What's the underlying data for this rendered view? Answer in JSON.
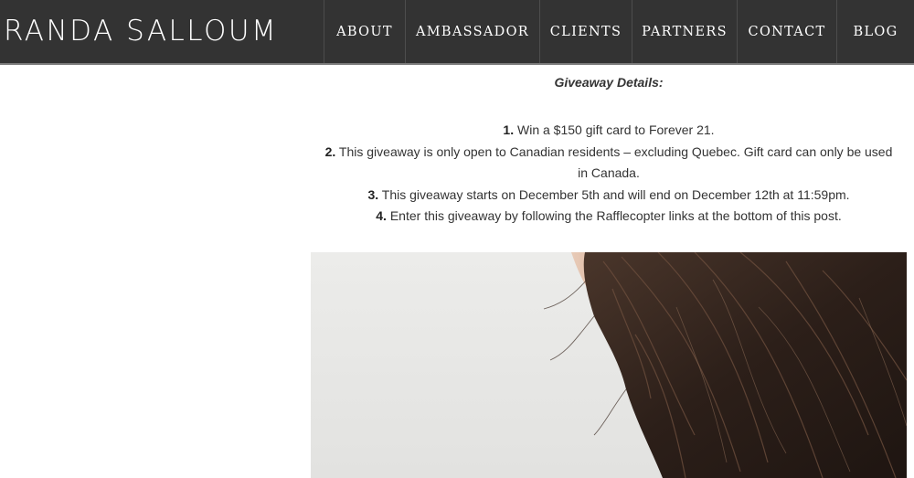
{
  "site": {
    "logo": "RANDA SALLOUM"
  },
  "nav": {
    "items": [
      {
        "label": "ABOUT"
      },
      {
        "label": "AMBASSADOR"
      },
      {
        "label": "CLIENTS"
      },
      {
        "label": "PARTNERS"
      },
      {
        "label": "CONTACT"
      },
      {
        "label": "BLOG"
      }
    ]
  },
  "post": {
    "giveaway_title": "Giveaway Details:",
    "details": [
      {
        "num": "1.",
        "text": " Win a $150 gift card to Forever 21."
      },
      {
        "num": "2.",
        "text": " This giveaway is only open to Canadian residents – excluding Quebec. Gift card can only be used in Canada."
      },
      {
        "num": "3.",
        "text": " This giveaway starts on December 5th and will end on December 12th at 11:59pm."
      },
      {
        "num": "4.",
        "text": " Enter this giveaway by following the Rafflecopter links at the bottom of this post."
      }
    ]
  },
  "colors": {
    "header_bg": "#333333",
    "header_text": "#ffffff",
    "body_text": "#333333",
    "hair": "#3a2a22"
  }
}
